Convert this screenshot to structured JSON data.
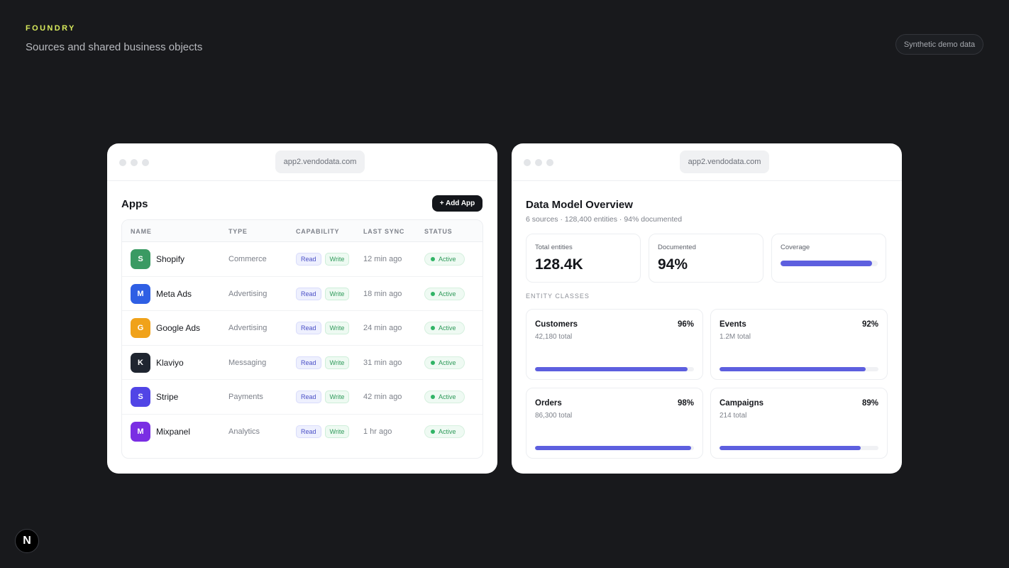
{
  "header": {
    "brand": "FOUNDRY",
    "subtitle": "Sources and shared business objects",
    "chip": "Synthetic demo data"
  },
  "apps_window": {
    "url": "app2.vendodata.com",
    "title": "Apps",
    "add_button": "+ Add App",
    "columns": [
      "NAME",
      "TYPE",
      "CAPABILITY",
      "LAST SYNC",
      "STATUS"
    ],
    "rows": [
      {
        "initial": "S",
        "name": "Shopify",
        "type": "Commerce",
        "read": "Read",
        "write": "Write",
        "sync": "12 min ago",
        "status": "Active",
        "color": "#3a9a63"
      },
      {
        "initial": "M",
        "name": "Meta Ads",
        "type": "Advertising",
        "read": "Read",
        "write": "Write",
        "sync": "18 min ago",
        "status": "Active",
        "color": "#2f5fe4"
      },
      {
        "initial": "G",
        "name": "Google Ads",
        "type": "Advertising",
        "read": "Read",
        "write": "Write",
        "sync": "24 min ago",
        "status": "Active",
        "color": "#f0a21a"
      },
      {
        "initial": "K",
        "name": "Klaviyo",
        "type": "Messaging",
        "read": "Read",
        "write": "Write",
        "sync": "31 min ago",
        "status": "Active",
        "color": "#1f2530"
      },
      {
        "initial": "S",
        "name": "Stripe",
        "type": "Payments",
        "read": "Read",
        "write": "Write",
        "sync": "42 min ago",
        "status": "Active",
        "color": "#5145e6"
      },
      {
        "initial": "M",
        "name": "Mixpanel",
        "type": "Analytics",
        "read": "Read",
        "write": "Write",
        "sync": "1 hr ago",
        "status": "Active",
        "color": "#7a2ee3"
      }
    ]
  },
  "data_model": {
    "url": "app2.vendodata.com",
    "title": "Data Model Overview",
    "subtitle": "6 sources · 128,400 entities · 94% documented",
    "stats": {
      "total_label": "Total entities",
      "total_value": "128.4K",
      "documented_label": "Documented",
      "documented_value": "94%",
      "coverage_label": "Coverage",
      "coverage_fraction": 0.94
    },
    "section_label": "ENTITY CLASSES",
    "entities": [
      {
        "name": "Customers",
        "pct": "96%",
        "total": "42,180 total",
        "fraction": 0.96
      },
      {
        "name": "Events",
        "pct": "92%",
        "total": "1.2M total",
        "fraction": 0.92
      },
      {
        "name": "Orders",
        "pct": "98%",
        "total": "86,300 total",
        "fraction": 0.98
      },
      {
        "name": "Campaigns",
        "pct": "89%",
        "total": "214 total",
        "fraction": 0.89
      }
    ]
  },
  "logo": {
    "letter": "N"
  }
}
